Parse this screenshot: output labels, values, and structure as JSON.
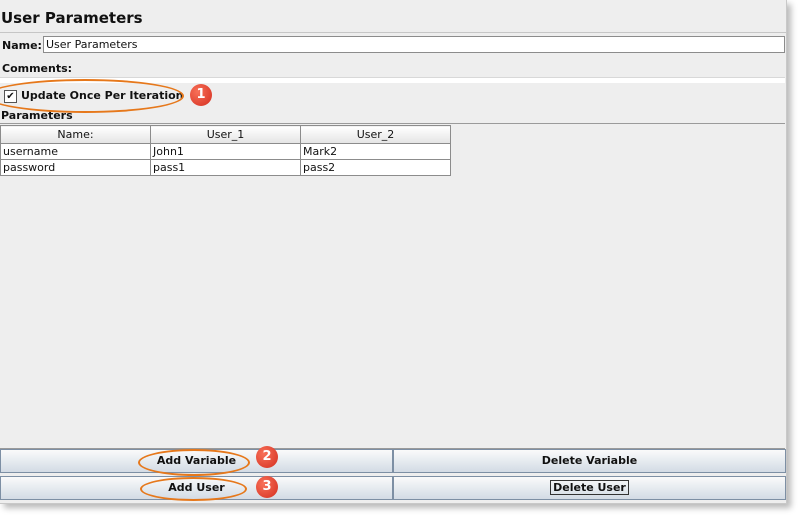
{
  "panel": {
    "title": "User Parameters"
  },
  "form": {
    "name_label": "Name:",
    "name_value": "User Parameters",
    "comments_label": "Comments:",
    "update_checkbox": {
      "label": "Update Once Per Iteration",
      "checked": true,
      "mark": "✔"
    }
  },
  "parameters": {
    "label": "Parameters",
    "columns": [
      "Name:",
      "User_1",
      "User_2"
    ],
    "rows": [
      [
        "username",
        "John1",
        "Mark2"
      ],
      [
        "password",
        "pass1",
        "pass2"
      ]
    ]
  },
  "buttons": {
    "add_variable": "Add Variable",
    "delete_variable": "Delete Variable",
    "add_user": "Add User",
    "delete_user": "Delete User"
  },
  "annotations": {
    "badge_1": "1",
    "badge_2": "2",
    "badge_3": "3",
    "highlight_color": "#e6781b",
    "badge_color": "#d42e1f"
  }
}
